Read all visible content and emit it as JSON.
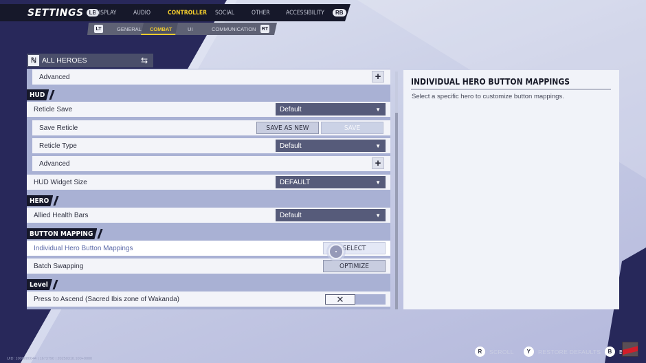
{
  "header": {
    "title": "SETTINGS",
    "prev_bumper": "LB",
    "next_bumper": "RB",
    "tabs": [
      {
        "label": "DISPLAY",
        "active": false
      },
      {
        "label": "AUDIO",
        "active": false
      },
      {
        "label": "CONTROLLER",
        "active": true
      },
      {
        "label": "SOCIAL",
        "active": false
      },
      {
        "label": "OTHER",
        "active": false
      },
      {
        "label": "ACCESSIBILITY",
        "active": false
      }
    ],
    "subtabs": {
      "prev_trigger": "LT",
      "next_trigger": "RT",
      "items": [
        {
          "label": "GENERAL",
          "active": false
        },
        {
          "label": "COMBAT",
          "active": true
        },
        {
          "label": "UI",
          "active": false
        },
        {
          "label": "COMMUNICATION",
          "active": false
        }
      ]
    }
  },
  "hero_selector": {
    "label": "ALL HEROES",
    "icon": "hero-logo-icon",
    "swap_icon": "swap-arrows-icon"
  },
  "settings": {
    "advanced_top": {
      "label": "Advanced",
      "action": "+"
    },
    "sections": {
      "hud": "HUD",
      "hero": "HERO",
      "button_mapping": "BUTTON MAPPING",
      "level": "Level"
    },
    "reticle_save": {
      "label": "Reticle Save",
      "value": "Default"
    },
    "save_reticle": {
      "label": "Save Reticle",
      "save_as_new": "SAVE AS NEW",
      "save": "SAVE"
    },
    "reticle_type": {
      "label": "Reticle Type",
      "value": "Default"
    },
    "reticle_advanced": {
      "label": "Advanced",
      "action": "+"
    },
    "hud_widget_size": {
      "label": "HUD Widget Size",
      "value": "DEFAULT"
    },
    "allied_health_bars": {
      "label": "Allied Health Bars",
      "value": "Default"
    },
    "individual_hero_mappings": {
      "label": "Individual Hero Button Mappings",
      "action": "SELECT"
    },
    "batch_swapping": {
      "label": "Batch Swapping",
      "action": "OPTIMIZE"
    },
    "press_to_ascend": {
      "label": "Press to Ascend (Sacred Ibis zone of Wakanda)",
      "value": "✕",
      "enabled": false
    }
  },
  "info_panel": {
    "title": "INDIVIDUAL HERO BUTTON MAPPINGS",
    "description": "Select a specific hero to customize button mappings."
  },
  "footer": {
    "scroll": {
      "key": "R",
      "label": "SCROLL"
    },
    "restore": {
      "key": "Y",
      "label": "RESTORE DEFAULTS"
    },
    "back": {
      "key": "B",
      "label": "BA"
    },
    "uid_text": "UID: 1000080044 | 1673790 | 20250310.100+0000"
  },
  "colors": {
    "accent_yellow": "#f2cc2d",
    "nav_dark": "#16182a",
    "dropdown_bg": "#565b7a",
    "highlight_text": "#5c6aa8"
  }
}
